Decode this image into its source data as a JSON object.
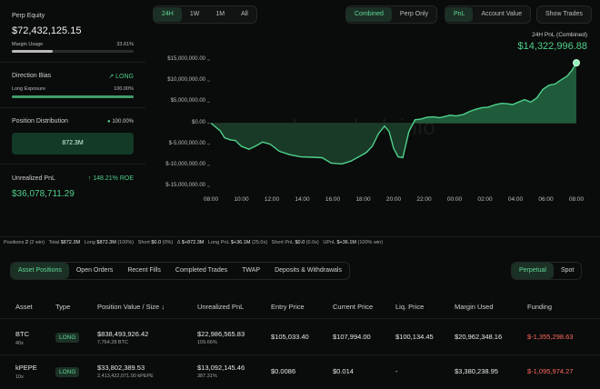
{
  "account": {
    "perp_equity_label": "Perp Equity",
    "perp_equity_value": "$72,432,125.15",
    "margin_usage_label": "Margin Usage",
    "margin_usage_value": "33.61%",
    "margin_usage_fraction": 0.3361,
    "direction_bias_label": "Direction Bias",
    "direction_bias_value": "LONG",
    "long_exposure_label": "Long Exposure",
    "long_exposure_value": "100.00%",
    "long_exposure_fraction": 1.0,
    "position_distribution_label": "Position Distribution",
    "position_distribution_pct": "100.00%",
    "position_distribution_value": "872.3M",
    "unrealized_pnl_label": "Unrealized PnL",
    "unrealized_roe": "148.21% ROE",
    "unrealized_pnl_value": "$36,078,711.29"
  },
  "chart_controls": {
    "ranges": [
      "24H",
      "1W",
      "1M",
      "All"
    ],
    "active_range": "24H",
    "mode": [
      "Combined",
      "Perp Only"
    ],
    "active_mode": "Combined",
    "metric": [
      "PnL",
      "Account Value"
    ],
    "active_metric": "PnL",
    "show_trades": "Show Trades"
  },
  "chart_header": {
    "label": "24H PnL (Combined)",
    "value": "$14,322,996.88"
  },
  "watermark": "hyperdash.info",
  "chart_data": {
    "type": "area",
    "y_ticks": [
      "$15,000,000.00",
      "$10,000,000.00",
      "$5,000,000.00",
      "$0.00",
      "$-5,000,000.00",
      "$-10,000,000.00",
      "$-15,000,000.00"
    ],
    "ylim": [
      -15000000,
      15000000
    ],
    "x_ticks": [
      "08:00",
      "10:00",
      "12:00",
      "14:00",
      "16:00",
      "18:00",
      "20:00",
      "22:00",
      "00:00",
      "02:00",
      "04:00",
      "06:00",
      "08:00"
    ],
    "hours_from_start": [
      0,
      0.6,
      0.9,
      1.3,
      1.6,
      2.0,
      2.5,
      3.0,
      3.4,
      3.9,
      4.5,
      5.2,
      5.9,
      6.6,
      7.3,
      7.9,
      8.6,
      9.2,
      9.7,
      10.2,
      10.6,
      11.0,
      11.4,
      11.7,
      12.0,
      12.3,
      12.6,
      13.0,
      13.4,
      13.8,
      14.2,
      14.6,
      15.0,
      15.4,
      15.7,
      16.1,
      16.6,
      17.0,
      17.4,
      17.8,
      18.2,
      18.7,
      19.1,
      19.5,
      19.8,
      20.2,
      20.6,
      21.0,
      21.4,
      21.8,
      22.2,
      22.6,
      23.0,
      23.4,
      23.7,
      24.0
    ],
    "values": [
      0,
      -1800000,
      -3500000,
      -4000000,
      -4100000,
      -5500000,
      -6200000,
      -5300000,
      -4500000,
      -5000000,
      -6700000,
      -7500000,
      -8000000,
      -8100000,
      -8200000,
      -9500000,
      -9700000,
      -9000000,
      -8000000,
      -7000000,
      -5500000,
      -2500000,
      -700000,
      -2000000,
      -6000000,
      -8000000,
      -8200000,
      -2000000,
      800000,
      1000000,
      1400000,
      1500000,
      1300000,
      1600000,
      1900000,
      1700000,
      2100000,
      2800000,
      3300000,
      3700000,
      3800000,
      4400000,
      4700000,
      4600000,
      4400000,
      5000000,
      5600000,
      5000000,
      6000000,
      8000000,
      9000000,
      9300000,
      10300000,
      11200000,
      12500000,
      14322996.88
    ],
    "colors": {
      "line": "#4fd18b",
      "area_positive": "#1f5b3b",
      "area_negative": "#1a3a28"
    }
  },
  "stats": {
    "positions_label": "Positions",
    "positions_count": "2",
    "positions_note": "(2 win)",
    "total_label": "Total",
    "total_value": "$872.3M",
    "long_label": "Long",
    "long_value": "$872.3M",
    "long_pct": "(100%)",
    "short_label": "Short",
    "short_value": "$0.0",
    "short_pct": "(0%)",
    "delta_label": "Δ",
    "delta_value": "$+872.3M",
    "long_pnl_label": "Long PnL",
    "long_pnl_value": "$+36.1M",
    "long_pnl_x": "(25.0x)",
    "short_pnl_label": "Short PnL",
    "short_pnl_value": "$0.0",
    "short_pnl_x": "(0.0x)",
    "upnl_label": "UPnL",
    "upnl_value": "$+36.1M",
    "upnl_note": "(100% win)"
  },
  "tabs": [
    "Asset Positions",
    "Open Orders",
    "Recent Fills",
    "Completed Trades",
    "TWAP",
    "Deposits & Withdrawals"
  ],
  "active_tab": "Asset Positions",
  "market_toggle": [
    "Perpetual",
    "Spot"
  ],
  "active_market": "Perpetual",
  "table": {
    "headers": [
      "Asset",
      "Type",
      "Position Value / Size",
      "Unrealized PnL",
      "Entry Price",
      "Current Price",
      "Liq. Price",
      "Margin Used",
      "Funding"
    ],
    "rows": [
      {
        "asset": "BTC",
        "leverage": "40x",
        "type": "LONG",
        "value": "$838,493,926.42",
        "size": "7,764.28 BTC",
        "pnl": "$22,986,565.83",
        "pnl_pct": "109.66%",
        "entry": "$105,033.40",
        "current": "$107,994.00",
        "liq": "$100,134.45",
        "margin": "$20,962,348.16",
        "funding": "$-1,355,298.63"
      },
      {
        "asset": "kPEPE",
        "leverage": "10x",
        "type": "LONG",
        "value": "$33,802,389.53",
        "size": "2,413,422,071.00 kPEPE",
        "pnl": "$13,092,145.46",
        "pnl_pct": "387.31%",
        "entry": "$0.0086",
        "current": "$0.014",
        "liq": "-",
        "margin": "$3,380,238.95",
        "funding": "$-1,095,974.27"
      }
    ]
  }
}
